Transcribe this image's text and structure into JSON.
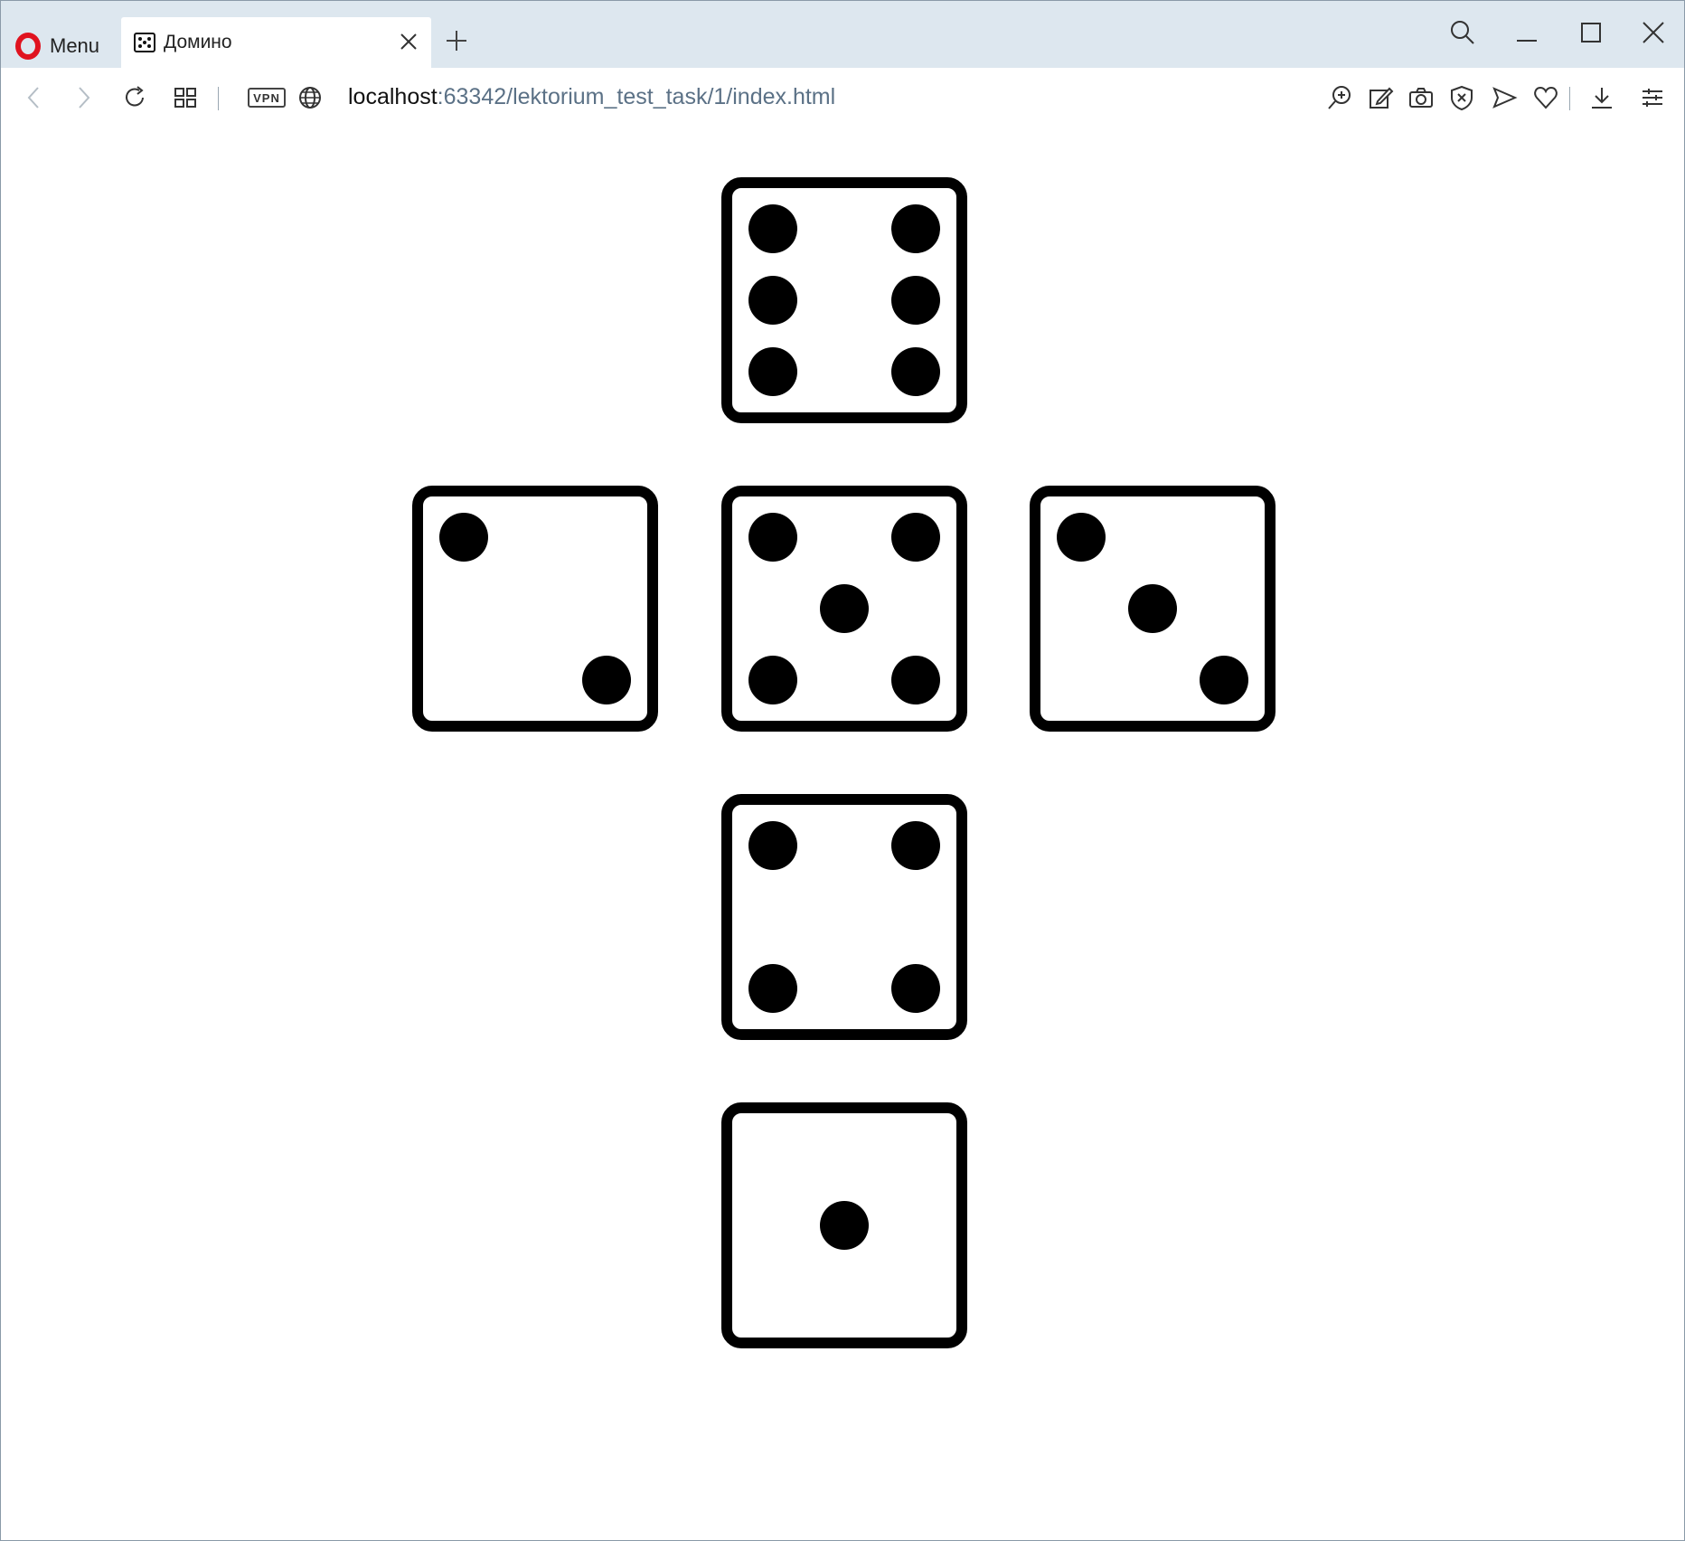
{
  "browser": {
    "menu_label": "Menu",
    "tab": {
      "title": "Домино"
    },
    "address": {
      "host": "localhost",
      "path": ":63342/lektorium_test_task/1/index.html"
    },
    "vpn_label": "VPN"
  },
  "dice": [
    {
      "position": "top",
      "value": 6
    },
    {
      "position": "middle-left",
      "value": 2
    },
    {
      "position": "middle-center",
      "value": 5
    },
    {
      "position": "middle-right",
      "value": 3
    },
    {
      "position": "lower",
      "value": 4
    },
    {
      "position": "bottom",
      "value": 1
    }
  ]
}
